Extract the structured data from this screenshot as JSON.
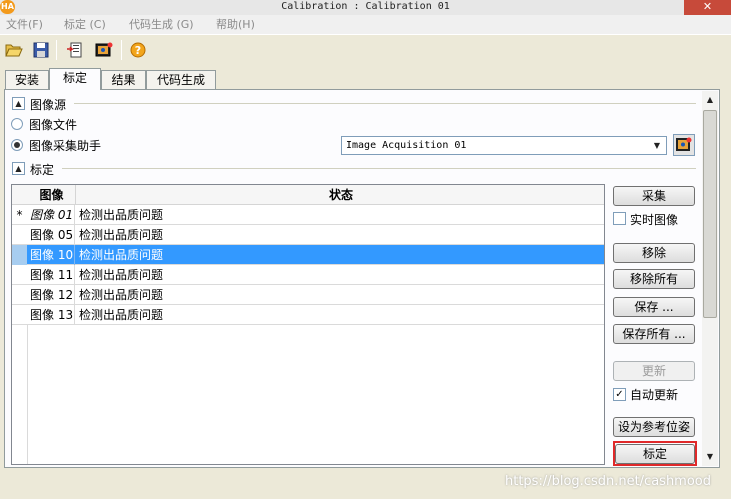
{
  "window": {
    "logo_text": "HA",
    "title": "Calibration : Calibration 01",
    "close_glyph": "✕"
  },
  "menu": [
    {
      "label": "文件(F)"
    },
    {
      "label": "标定 (C)"
    },
    {
      "label": "代码生成 (G)"
    },
    {
      "label": "帮助(H)"
    }
  ],
  "toolbar": {
    "icons": [
      "open-folder-icon",
      "save-icon",
      "export-icon",
      "image-acquisition-icon",
      "help-icon"
    ]
  },
  "tabs": [
    {
      "label": "安装",
      "active": false
    },
    {
      "label": "标定",
      "active": true
    },
    {
      "label": "结果",
      "active": false
    },
    {
      "label": "代码生成",
      "active": false
    }
  ],
  "image_source": {
    "section_label": "图像源",
    "collapse_glyph": "▲",
    "options": [
      {
        "label": "图像文件",
        "selected": false
      },
      {
        "label": "图像采集助手",
        "selected": true
      }
    ],
    "assistant_select": {
      "value": "Image Acquisition 01",
      "arrow": "▼"
    }
  },
  "calibration": {
    "section_label": "标定",
    "collapse_glyph": "▲",
    "table": {
      "headers": [
        "图像",
        "状态"
      ],
      "rows": [
        {
          "marker": "*",
          "image": "图像 01",
          "status": "检测出品质问题",
          "selected": false
        },
        {
          "marker": "",
          "image": "图像 05",
          "status": "检测出品质问题",
          "selected": false
        },
        {
          "marker": "",
          "image": "图像 10",
          "status": "检测出品质问题",
          "selected": true
        },
        {
          "marker": "",
          "image": "图像 11",
          "status": "检测出品质问题",
          "selected": false
        },
        {
          "marker": "",
          "image": "图像 12",
          "status": "检测出品质问题",
          "selected": false
        },
        {
          "marker": "",
          "image": "图像 13",
          "status": "检测出品质问题",
          "selected": false
        }
      ]
    },
    "buttons": {
      "acquire": "采集",
      "live_image": "实时图像",
      "remove": "移除",
      "remove_all": "移除所有",
      "save": "保存 ...",
      "save_all": "保存所有 ...",
      "update": "更新",
      "auto_update": "自动更新",
      "set_reference_pose": "设为参考位姿",
      "calibrate": "标定"
    },
    "live_image_checked": false,
    "auto_update_checked": true,
    "checkmark": "✓"
  },
  "scrollbar": {
    "up": "▲",
    "down": "▼"
  },
  "watermark": "https://blog.csdn.net/cashmood",
  "colors": {
    "selection": "#3399ff",
    "highlight_border": "#e0292a",
    "logo": "#f39a1c"
  }
}
